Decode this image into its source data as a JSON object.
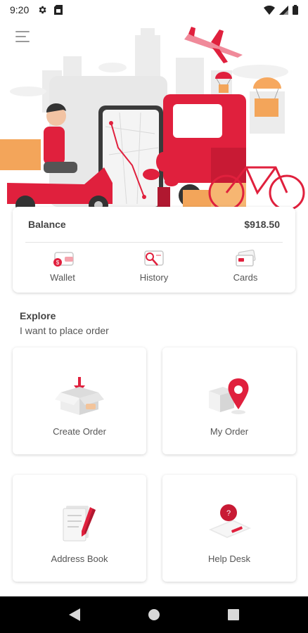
{
  "status_bar": {
    "time": "9:20"
  },
  "icons": {
    "menu": "hamburger-menu-icon",
    "settings": "gear-icon",
    "sim": "sim-card-icon",
    "wifi": "wifi-icon",
    "signal": "cell-signal-icon",
    "battery": "battery-icon"
  },
  "balance": {
    "label": "Balance",
    "amount": "$918.50"
  },
  "quick_actions": [
    {
      "label": "Wallet",
      "icon": "wallet-icon"
    },
    {
      "label": "History",
      "icon": "history-icon"
    },
    {
      "label": "Cards",
      "icon": "cards-icon"
    }
  ],
  "explore": {
    "title": "Explore",
    "subtitle": "I want to place order"
  },
  "tiles": [
    {
      "label": "Create Order",
      "icon": "open-box-icon"
    },
    {
      "label": "My Order",
      "icon": "location-pin-box-icon"
    },
    {
      "label": "Address Book",
      "icon": "notebook-pen-icon"
    },
    {
      "label": "Help Desk",
      "icon": "help-desk-phone-icon"
    }
  ],
  "colors": {
    "accent": "#e0203d",
    "accent_light": "#f4a3ad",
    "orange": "#f3a55a"
  }
}
